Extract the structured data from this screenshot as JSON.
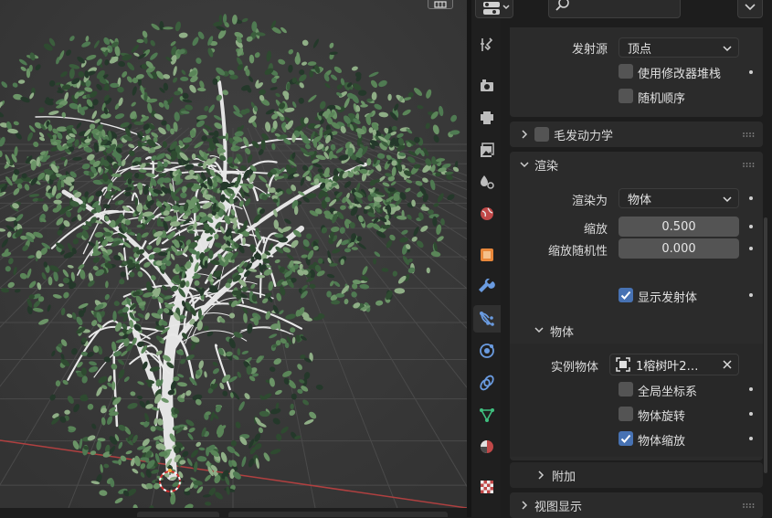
{
  "header": {
    "editor_type_icon": "properties-editor-icon",
    "search_icon": "search-icon",
    "menu_icon": "chevron-down-icon"
  },
  "tabs": [
    {
      "name": "tool-tab",
      "icon": "tool-icon",
      "active": false
    },
    {
      "name": "render-tab",
      "icon": "render-icon",
      "active": false
    },
    {
      "name": "output-tab",
      "icon": "output-icon",
      "active": false
    },
    {
      "name": "view-layer-tab",
      "icon": "view-layer-icon",
      "active": false
    },
    {
      "name": "scene-tab",
      "icon": "scene-icon",
      "active": false
    },
    {
      "name": "world-tab",
      "icon": "world-icon",
      "active": false
    },
    {
      "name": "object-tab",
      "icon": "object-icon",
      "active": false
    },
    {
      "name": "modifier-tab",
      "icon": "wrench-icon",
      "active": false
    },
    {
      "name": "particles-tab",
      "icon": "particles-icon",
      "active": true
    },
    {
      "name": "physics-tab",
      "icon": "physics-icon",
      "active": false
    },
    {
      "name": "constraints-tab",
      "icon": "constraints-icon",
      "active": false
    },
    {
      "name": "data-tab",
      "icon": "mesh-data-icon",
      "active": false
    },
    {
      "name": "material-tab",
      "icon": "material-icon",
      "active": false
    },
    {
      "name": "texture-tab",
      "icon": "texture-icon",
      "active": false
    }
  ],
  "emission": {
    "source_label": "发射源",
    "source_value": "顶点",
    "use_modifier_stack_label": "使用修改器堆栈",
    "use_modifier_stack": false,
    "random_order_label": "随机顺序",
    "random_order": false
  },
  "hair_dynamics": {
    "label": "毛发动力学",
    "enabled": false
  },
  "render": {
    "title": "渲染",
    "render_as_label": "渲染为",
    "render_as_value": "物体",
    "scale_label": "缩放",
    "scale_value": "0.500",
    "scale_random_label": "缩放随机性",
    "scale_random_value": "0.000",
    "show_emitter_label": "显示发射体",
    "show_emitter": true
  },
  "object": {
    "title": "物体",
    "instance_object_label": "实例物体",
    "instance_object_value": "1榕树叶2…",
    "global_coords_label": "全局坐标系",
    "global_coords": false,
    "object_rotation_label": "物体旋转",
    "object_rotation": false,
    "object_scale_label": "物体缩放",
    "object_scale": true
  },
  "extra": {
    "title": "附加"
  },
  "viewport_display": {
    "title": "视图显示"
  },
  "colors": {
    "accent": "#4772b3",
    "panel": "#2b2b2b",
    "background": "#1d1d1d",
    "viewport": "#3a3a3a",
    "leaf_dark": "#2e4a30",
    "leaf_light": "#8fae86",
    "trunk": "#e4e4e4",
    "axis_x": "#b04040"
  }
}
